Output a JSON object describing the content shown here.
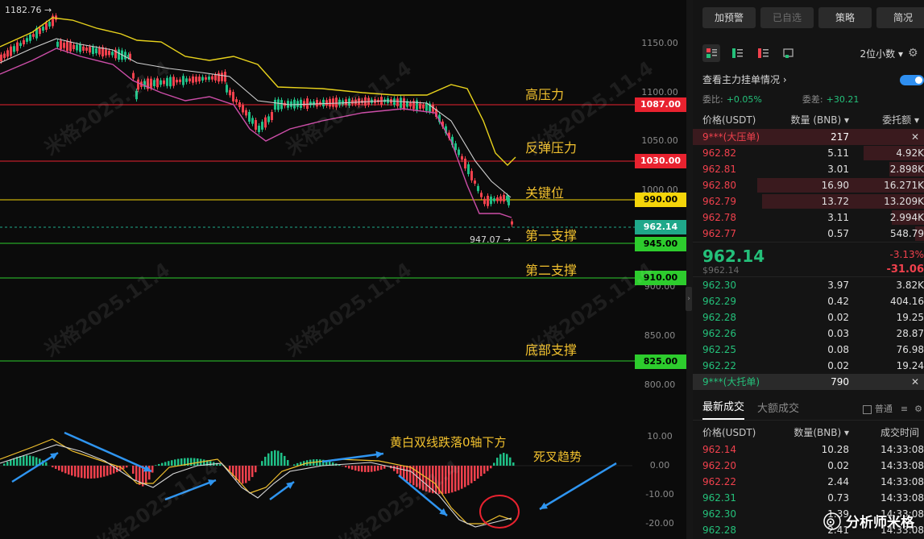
{
  "chart": {
    "high_label": "1182.76 →",
    "low_label": "947.07 →",
    "watermark": "米格2025.11.4",
    "price_axis": [
      "1150.00",
      "1100.00",
      "1050.00",
      "1000.00",
      "900.00",
      "850.00",
      "800.00"
    ],
    "macd_axis": [
      "10.00",
      "0.00",
      "-10.00",
      "-20.00"
    ],
    "levels": [
      {
        "label": "高压力",
        "tag": "1087.00",
        "tag_color": "#e8222f",
        "text_color": "#ffffff",
        "line_color": "#e8222f"
      },
      {
        "label": "反弹压力",
        "tag": "1030.00",
        "tag_color": "#e8222f",
        "text_color": "#ffffff",
        "line_color": "#e8222f"
      },
      {
        "label": "关键位",
        "tag": "990.00",
        "tag_color": "#f5d50a",
        "text_color": "#000000",
        "line_color": "#f5d50a"
      },
      {
        "label": "第一支撑",
        "tag": "945.00",
        "tag_color": "#2dcc2d",
        "text_color": "#000000",
        "line_color": "#2dcc2d"
      },
      {
        "label": "第二支撑",
        "tag": "910.00",
        "tag_color": "#2dcc2d",
        "text_color": "#000000",
        "line_color": "#2dcc2d"
      },
      {
        "label": "底部支撑",
        "tag": "825.00",
        "tag_color": "#2dcc2d",
        "text_color": "#000000",
        "line_color": "#2dcc2d"
      }
    ],
    "current_tag": "962.14",
    "current_tag_color": "#1fa88a",
    "annotation_1": "黄白双线跌落0轴下方",
    "annotation_2": "死叉趋势"
  },
  "panel": {
    "buttons": [
      "加预警",
      "已自选",
      "策略",
      "简况"
    ],
    "precision": "2位小数",
    "main_force": "查看主力挂单情况",
    "ratio_label": "委比:",
    "ratio_value": "+0.05%",
    "diff_label": "委差:",
    "diff_value": "+30.21",
    "headers": [
      "价格(USDT)",
      "数量 (BNB)",
      "委托额"
    ],
    "big_ask": {
      "name": "9***(大压单)",
      "qty": "217"
    },
    "asks": [
      {
        "price": "962.82",
        "qty": "5.11",
        "total": "4.92K",
        "depth": 0.26
      },
      {
        "price": "962.81",
        "qty": "3.01",
        "total": "2.898K",
        "depth": 0.15
      },
      {
        "price": "962.80",
        "qty": "16.90",
        "total": "16.271K",
        "depth": 0.72
      },
      {
        "price": "962.79",
        "qty": "13.72",
        "total": "13.209K",
        "depth": 0.7
      },
      {
        "price": "962.78",
        "qty": "3.11",
        "total": "2.994K",
        "depth": 0.14
      },
      {
        "price": "962.77",
        "qty": "0.57",
        "total": "548.79",
        "depth": 0.04
      }
    ],
    "last_price": "962.14",
    "last_sub": "$962.14",
    "change_pct": "-3.13%",
    "change_abs": "-31.06",
    "bids": [
      {
        "price": "962.30",
        "qty": "3.97",
        "total": "3.82K"
      },
      {
        "price": "962.29",
        "qty": "0.42",
        "total": "404.16"
      },
      {
        "price": "962.28",
        "qty": "0.02",
        "total": "19.25"
      },
      {
        "price": "962.26",
        "qty": "0.03",
        "total": "28.87"
      },
      {
        "price": "962.25",
        "qty": "0.08",
        "total": "76.98"
      },
      {
        "price": "962.22",
        "qty": "0.02",
        "total": "19.24"
      }
    ],
    "big_bid": {
      "name": "9***(大托单)",
      "qty": "790"
    },
    "trade_tabs": [
      "最新成交",
      "大额成交"
    ],
    "normal_label": "普通",
    "trade_headers": [
      "价格(USDT)",
      "数量(BNB)",
      "成交时间"
    ],
    "trades": [
      {
        "price": "962.14",
        "qty": "10.28",
        "time": "14:33:08",
        "side": "red"
      },
      {
        "price": "962.20",
        "qty": "0.02",
        "time": "14:33:08",
        "side": "red"
      },
      {
        "price": "962.22",
        "qty": "2.44",
        "time": "14:33:08",
        "side": "red"
      },
      {
        "price": "962.31",
        "qty": "0.73",
        "time": "14:33:08",
        "side": "green"
      },
      {
        "price": "962.30",
        "qty": "1.39",
        "time": "14:33:08",
        "side": "green"
      },
      {
        "price": "962.28",
        "qty": "2.41",
        "time": "14:33:08",
        "side": "green"
      }
    ],
    "brand": "分析师米格"
  }
}
